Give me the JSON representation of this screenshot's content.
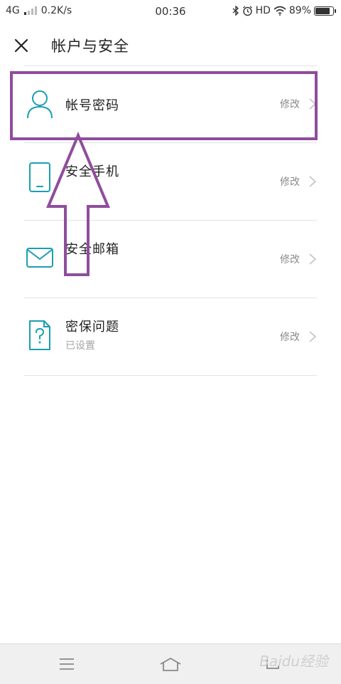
{
  "status_bar": {
    "network": "4G",
    "speed": "0.2K/s",
    "time": "00:36",
    "hd": "HD",
    "battery": "89%",
    "battery_level": 0.89
  },
  "header": {
    "title": "帐户与安全"
  },
  "items": [
    {
      "title": "帐号密码",
      "subtitle": "",
      "action": "修改",
      "icon": "user-icon"
    },
    {
      "title": "安全手机",
      "subtitle": "",
      "action": "修改",
      "icon": "phone-icon"
    },
    {
      "title": "安全邮箱",
      "subtitle": "",
      "action": "修改",
      "icon": "mail-icon"
    },
    {
      "title": "密保问题",
      "subtitle": "已设置",
      "action": "修改",
      "icon": "question-doc-icon"
    }
  ],
  "watermark": "Baidu经验",
  "colors": {
    "accent": "#1a9fb0",
    "highlight": "#8f4d9b"
  }
}
